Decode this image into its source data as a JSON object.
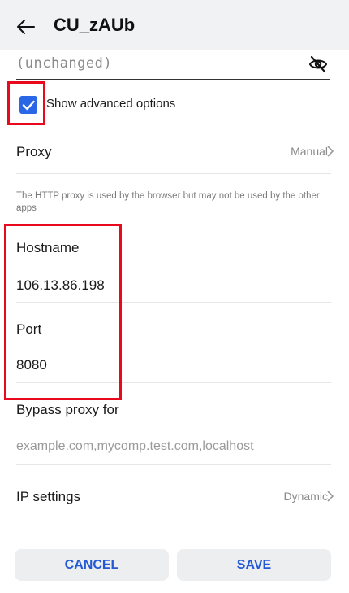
{
  "header": {
    "title": "CU_zAUb",
    "back_icon": "arrow-left-icon"
  },
  "password": {
    "value": "(unchanged)",
    "toggle_icon": "eye-off-icon"
  },
  "advanced": {
    "label": "Show advanced options",
    "checked": true
  },
  "proxy": {
    "label": "Proxy",
    "value": "Manual",
    "note": "The HTTP proxy is used by the browser but may not be used by the other apps"
  },
  "hostname": {
    "label": "Hostname",
    "value": "106.13.86.198"
  },
  "port": {
    "label": "Port",
    "value": "8080"
  },
  "bypass": {
    "label": "Bypass proxy for",
    "placeholder": "example.com,mycomp.test.com,localhost"
  },
  "ip_settings": {
    "label": "IP settings",
    "value": "Dynamic"
  },
  "buttons": {
    "cancel": "CANCEL",
    "save": "SAVE"
  },
  "colors": {
    "accent": "#2a67e6",
    "button_text": "#2459d6",
    "highlight": "#e8091c"
  }
}
